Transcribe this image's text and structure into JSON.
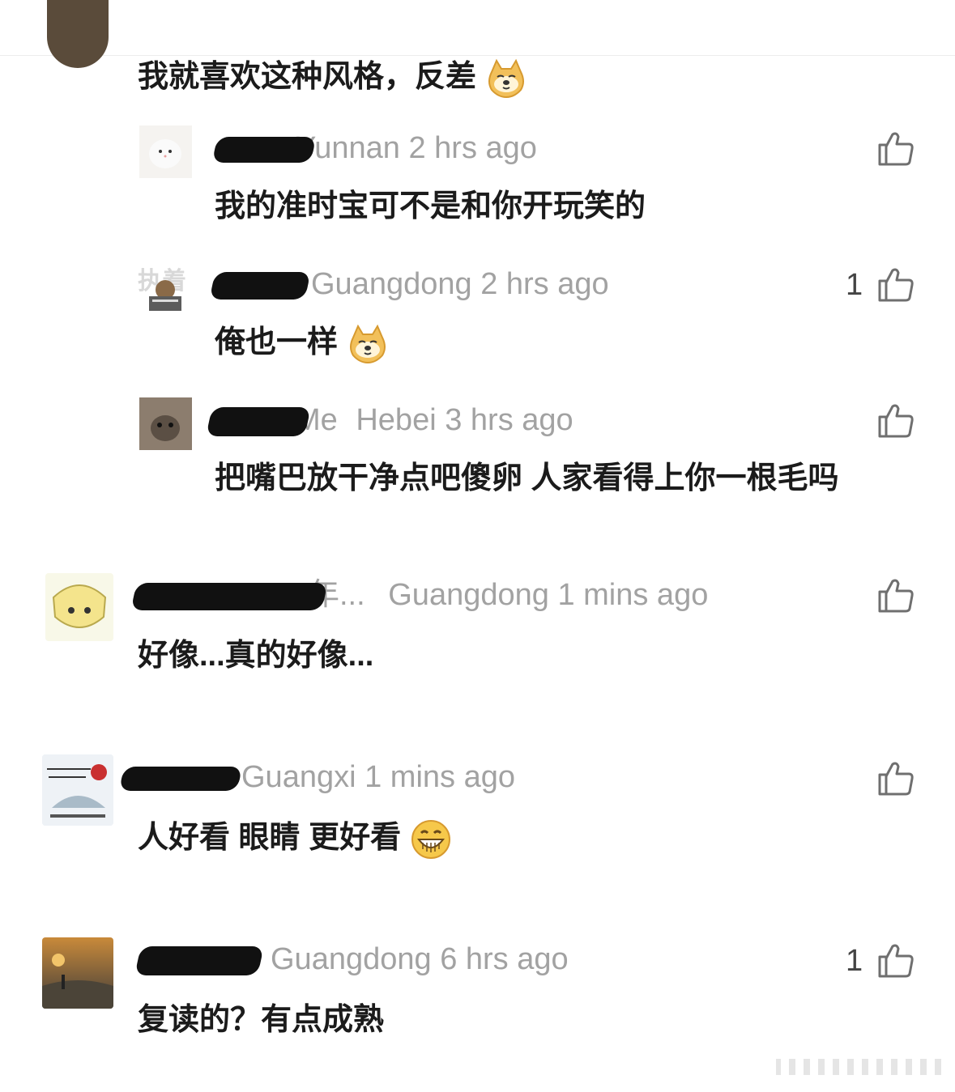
{
  "top_comment": {
    "text": "我就喜欢这种风格，反差"
  },
  "replies": [
    {
      "location": "Yunnan",
      "name_suffix": "Yunnan",
      "time": "2 hrs ago",
      "text": "我的准时宝可不是和你开玩笑的",
      "likes": ""
    },
    {
      "location": "Guangdong",
      "name_suffix": "Guangdong",
      "time": "2 hrs ago",
      "text": "俺也一样",
      "likes": "1"
    },
    {
      "location": "Hebei",
      "name_suffix": "Me",
      "time": "3 hrs ago",
      "text": "把嘴巴放干净点吧傻卵 人家看得上你一根毛吗",
      "likes": ""
    }
  ],
  "comments": [
    {
      "name_suffix": "年...",
      "location": "Guangdong",
      "time": "1 mins ago",
      "text": "好像...真的好像...",
      "likes": ""
    },
    {
      "name_suffix": "",
      "location": "Guangxi",
      "time": "1 mins ago",
      "text": "人好看 眼睛 更好看",
      "likes": ""
    },
    {
      "name_suffix": "",
      "location": "Guangdong",
      "time": "6 hrs ago",
      "text": "复读的？有点成熟",
      "likes": "1"
    }
  ],
  "avatar_overlay_text": {
    "reply2": "执着"
  },
  "colors": {
    "meta": "#a2a2a2",
    "text": "#1b1b1b",
    "redaction": "#111111",
    "like_icon": "#6f6f6f"
  },
  "icons": [
    "thumbs-up-icon",
    "doge-emoji-icon",
    "grin-emoji-icon"
  ]
}
